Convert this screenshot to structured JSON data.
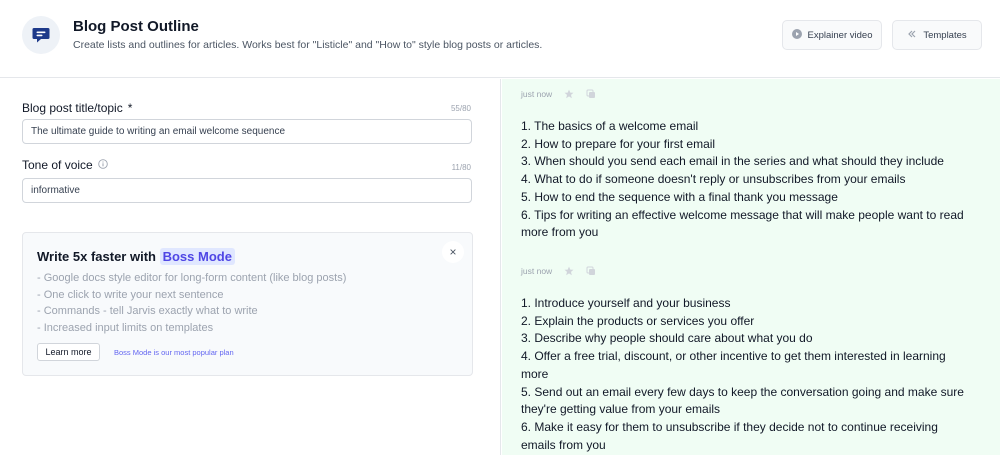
{
  "header": {
    "title": "Blog Post Outline",
    "subtitle": "Create lists and outlines for articles. Works best for \"Listicle\" and \"How to\" style blog posts or articles.",
    "explainer_label": "Explainer video",
    "templates_label": "Templates"
  },
  "form": {
    "title_field": {
      "label": "Blog post title/topic",
      "required_mark": "*",
      "counter": "55/80",
      "value": "The ultimate guide to writing an email welcome sequence"
    },
    "tone_field": {
      "label": "Tone of voice",
      "counter": "11/80",
      "value": "informative"
    }
  },
  "promo": {
    "title_prefix": "Write 5x faster with",
    "title_highlight": "Boss Mode",
    "features": [
      "- Google docs style editor for long-form content (like blog posts)",
      "- One click to write your next sentence",
      "- Commands - tell Jarvis exactly what to write",
      "- Increased input limits on templates"
    ],
    "learn_more": "Learn more",
    "popular_note": "Boss Mode is our most popular plan",
    "close_glyph": "×"
  },
  "results": [
    {
      "time": "just now",
      "lines": [
        "1. The basics of a welcome email",
        "2. How to prepare for your first email",
        "3. When should you send each email in the series and what should they include",
        "4. What to do if someone doesn't reply or unsubscribes from your emails",
        "5. How to end the sequence with a final thank you message",
        "6. Tips for writing an effective welcome message that will make people want to read",
        "more from you"
      ]
    },
    {
      "time": "just now",
      "lines": [
        "1. Introduce yourself and your business",
        "2. Explain the products or services you offer",
        "3. Describe why people should care about what you do",
        "4. Offer a free trial, discount, or other incentive to get them interested in learning",
        "more",
        "5. Send out an email every few days to keep the conversation going and make sure",
        "they're getting value from your emails",
        "6. Make it easy for them to unsubscribe if they decide not to continue receiving",
        "emails from you"
      ]
    }
  ],
  "colors": {
    "accent": "#4f46e5",
    "result_bg": "#f0fdf4",
    "icon_blue": "#1e3a8a"
  },
  "icons": {
    "app": "chat-bubble-icon",
    "video": "play-circle-icon",
    "templates": "chevrons-left-icon",
    "info": "info-icon",
    "favorite": "star-icon",
    "copy": "copy-icon",
    "close": "close-icon"
  }
}
